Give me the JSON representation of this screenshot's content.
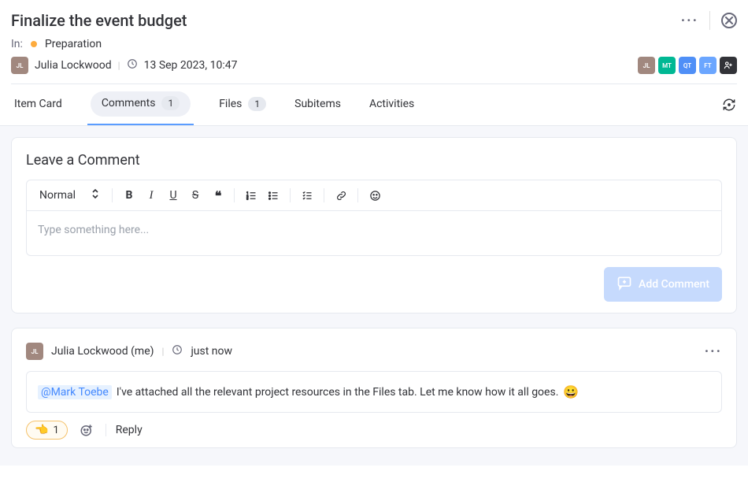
{
  "header": {
    "title": "Finalize the event budget"
  },
  "meta": {
    "in_label": "In:",
    "status": "Preparation",
    "author": "Julia Lockwood",
    "timestamp": "13 Sep 2023, 10:47",
    "avatars": [
      {
        "initials": "JL",
        "bg": "#a1887f"
      },
      {
        "initials": "MT",
        "bg": "#00b894"
      },
      {
        "initials": "QT",
        "bg": "#4f8ff7"
      },
      {
        "initials": "FT",
        "bg": "#6ba6ff"
      }
    ]
  },
  "tabs": {
    "item_card": "Item Card",
    "comments": "Comments",
    "comments_count": "1",
    "files": "Files",
    "files_count": "1",
    "subitems": "Subitems",
    "activities": "Activities"
  },
  "compose": {
    "title": "Leave a Comment",
    "format_select": "Normal",
    "placeholder": "Type something here...",
    "add_button": "Add Comment"
  },
  "comment": {
    "author": "Julia Lockwood (me)",
    "time": "just now",
    "mention": "@Mark Toebe",
    "body": "I've attached all the relevant project resources in the Files tab. Let me know how it all goes.",
    "emoji": "😀",
    "reaction_emoji": "👈",
    "reaction_count": "1",
    "reply": "Reply"
  }
}
